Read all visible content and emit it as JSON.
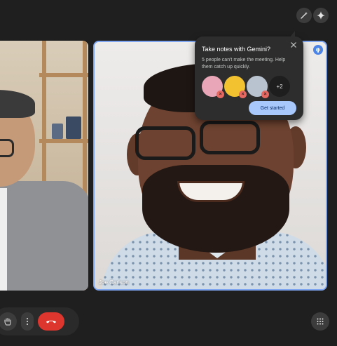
{
  "colors": {
    "background": "#1f1f1f",
    "accent": "#a8c7fa",
    "active_speaker_border": "#7fa6f0",
    "end_call": "#dc362e"
  },
  "top_actions": [
    {
      "icon": "magic-wand-icon"
    },
    {
      "icon": "gemini-sparkle-icon"
    }
  ],
  "main_tile": {
    "participant_name": "Joe Carlson",
    "speaking_icon": "audio-levels-icon"
  },
  "gemini_popup": {
    "title": "Take notes with Gemini?",
    "body": "5 people can't make the meeting. Help them catch up quickly.",
    "more_count": "+2",
    "primary_button": "Get started",
    "close_icon": "close-icon",
    "avatar_colors": [
      "#e8a6b8",
      "#f2c230",
      "#b9c3cf"
    ]
  },
  "controls": {
    "items": [
      "raise-hand-icon",
      "more-options-icon",
      "end-call-icon"
    ],
    "right_icon": "apps-grid-icon"
  }
}
